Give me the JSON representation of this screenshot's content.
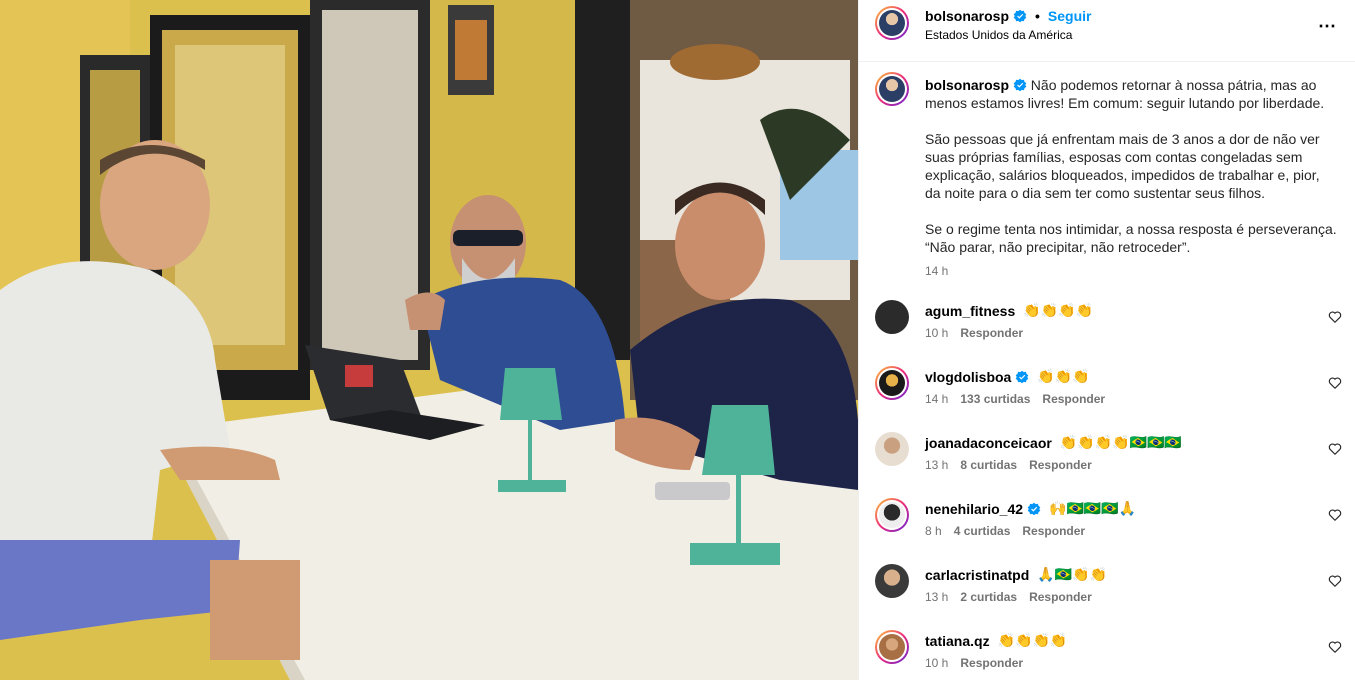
{
  "post": {
    "username": "bolsonarosp",
    "follow_label": "Seguir",
    "location": "Estados Unidos da América",
    "more_label": "⋯",
    "caption_paragraphs": [
      "Não podemos retornar à nossa pátria, mas ao menos estamos livres! Em comum: seguir lutando por liberdade.",
      "São pessoas que já enfrentam mais de 3 anos a dor de não ver suas próprias famílias, esposas com contas congeladas sem explicação, salários bloqueados, impedidos de trabalhar e, pior, da noite para o dia sem ter como sustentar seus filhos.",
      "Se o regime tenta nos intimidar, a nossa resposta é perseverança. “Não parar, não precipitar, não retroceder”."
    ],
    "caption_time": "14 h"
  },
  "comments": [
    {
      "user": "agum_fitness",
      "verified": false,
      "text": "👏👏👏👏",
      "time": "10 h",
      "likes": "",
      "reply": "Responder"
    },
    {
      "user": "vlogdolisboa",
      "verified": true,
      "text": "👏👏👏",
      "time": "14 h",
      "likes": "133 curtidas",
      "reply": "Responder"
    },
    {
      "user": "joanadaconceicaor",
      "verified": false,
      "text": "👏👏👏👏🇧🇷🇧🇷🇧🇷",
      "time": "13 h",
      "likes": "8 curtidas",
      "reply": "Responder"
    },
    {
      "user": "nenehilario_42",
      "verified": true,
      "text": "🙌🇧🇷🇧🇷🇧🇷🙏",
      "time": "8 h",
      "likes": "4 curtidas",
      "reply": "Responder"
    },
    {
      "user": "carlacristinatpd",
      "verified": false,
      "text": "🙏🇧🇷👏👏",
      "time": "13 h",
      "likes": "2 curtidas",
      "reply": "Responder"
    },
    {
      "user": "tatiana.qz",
      "verified": false,
      "text": "👏👏👏👏",
      "time": "10 h",
      "likes": "",
      "reply": "Responder"
    }
  ],
  "colors": {
    "link": "#0095f6",
    "muted": "#737373",
    "verified": "#0095f6"
  },
  "icons": {
    "verified": "verified-badge-icon",
    "heart": "heart-outline-icon",
    "more": "more-horizontal-icon"
  }
}
